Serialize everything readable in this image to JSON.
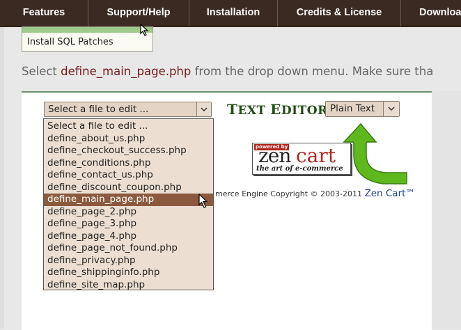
{
  "nav": {
    "items": [
      {
        "label": "Features",
        "width": 0
      },
      {
        "label": "Support/Help"
      },
      {
        "label": "Installation"
      },
      {
        "label": "Credits & License"
      },
      {
        "label": "Downloa"
      }
    ]
  },
  "menu_fragment": {
    "item_label": "Install SQL Patches"
  },
  "instruction": {
    "prefix": "Select ",
    "filename": "define_main_page.php",
    "suffix": " from the drop down menu. Make sure tha"
  },
  "file_select": {
    "current_value": "Select a file to edit ...",
    "options": [
      "Select a file to edit ...",
      "define_about_us.php",
      "define_checkout_success.php",
      "define_conditions.php",
      "define_contact_us.php",
      "define_discount_coupon.php",
      "define_main_page.php",
      "define_page_2.php",
      "define_page_3.php",
      "define_page_4.php",
      "define_page_not_found.php",
      "define_privacy.php",
      "define_shippinginfo.php",
      "define_site_map.php"
    ],
    "highlighted_index": 6
  },
  "editor": {
    "title_first": "T",
    "title_rest": "EXT ",
    "title_first2": "E",
    "title_rest2": "DITOR",
    "mode_value": "Plain Text"
  },
  "logo": {
    "powered": "powered by",
    "zen": "zen",
    "cart": "cart",
    "tagline": "the art of e-commerce"
  },
  "footer": {
    "copyright": "merce Engine Copyright © 2003-2011 ",
    "brand": "Zen Cart™"
  },
  "colors": {
    "nav_bg": "#3b2a21",
    "selected_option": "#8b5a3e",
    "editor_title": "#234c17",
    "arrow_green": "#5fb81e"
  }
}
